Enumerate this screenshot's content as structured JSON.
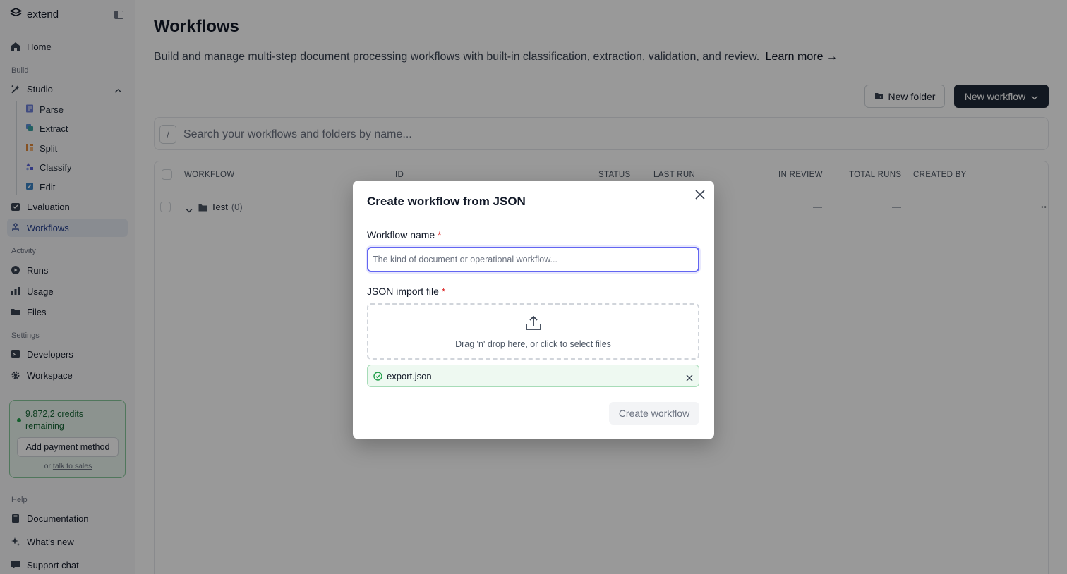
{
  "app": {
    "name": "extend"
  },
  "sidebar": {
    "home": "Home",
    "build_label": "Build",
    "studio": "Studio",
    "studio_items": [
      "Parse",
      "Extract",
      "Split",
      "Classify",
      "Edit"
    ],
    "evaluation": "Evaluation",
    "workflows": "Workflows",
    "activity_label": "Activity",
    "runs": "Runs",
    "usage": "Usage",
    "files": "Files",
    "settings_label": "Settings",
    "developers": "Developers",
    "workspace": "Workspace",
    "help_label": "Help",
    "documentation": "Documentation",
    "whats_new": "What's new",
    "support_chat": "Support chat"
  },
  "credits": {
    "text": "9.872,2 credits remaining",
    "add_payment": "Add payment method",
    "or": "or",
    "talk_to_sales": "talk to sales"
  },
  "page": {
    "title": "Workflows",
    "description": "Build and manage multi-step document processing workflows with built-in classification, extraction, validation, and review.",
    "learn_more": "Learn more →",
    "new_folder": "New folder",
    "new_workflow": "New workflow",
    "search_shortcut": "/",
    "search_placeholder": "Search your workflows and folders by name..."
  },
  "table": {
    "columns": [
      "WORKFLOW",
      "ID",
      "STATUS",
      "LAST RUN",
      "IN REVIEW",
      "TOTAL RUNS",
      "CREATED BY"
    ],
    "rows": [
      {
        "name": "Test",
        "count": "(0)",
        "in_review": "—",
        "total_runs": "—",
        "menu": "··"
      }
    ]
  },
  "modal": {
    "title": "Create workflow from JSON",
    "name_label": "Workflow name",
    "required_mark": "*",
    "name_placeholder": "The kind of document or operational workflow...",
    "name_value": "",
    "file_label": "JSON import file",
    "drop_hint": "Drag 'n' drop here, or click to select files",
    "file_name": "export.json",
    "create_button": "Create workflow"
  },
  "colors": {
    "accent": "#1f2937",
    "focus_ring": "#6366f1",
    "success": "#22a04b",
    "required": "#dc2626"
  }
}
